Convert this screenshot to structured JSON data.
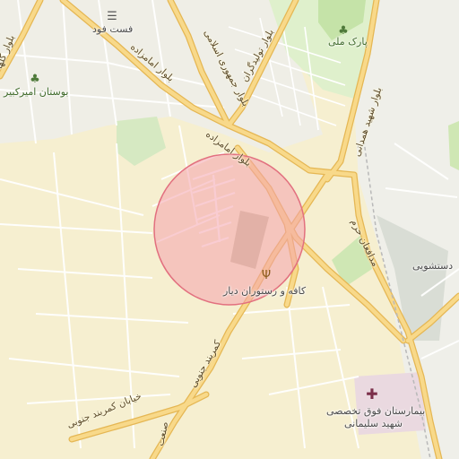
{
  "colors": {
    "land": "#f6efd0",
    "urban": "#efefe9",
    "park": "#cfe7b4",
    "water_grey": "#d7dcd6",
    "major_road": "#f6d27a",
    "major_road_edge": "#e5b754",
    "minor_road": "#ffffff",
    "circle_fill": "#f4a3ad",
    "circle_stroke": "#e2707f",
    "hospital": "#e7b7c4"
  },
  "pois": {
    "fast_food": "فست فود",
    "park_mellat": "پارک ملی",
    "amir_kabir_garden": "بوستان امیرکبیر",
    "cafe_dayar": "کافه و رستوران دیار",
    "dastshooyi": "دستشویی",
    "hospital_line1": "بیمارستان فوق تخصصی",
    "hospital_line2": "شهید سلیمانی"
  },
  "roads": {
    "golha": "بلوار گلها",
    "imamzadeh_top": "بلوار امامزاده",
    "jomhouri": "بلوار جمهوری اسلامی",
    "tolidgaran": "بلوار تولیدگران",
    "imamzadeh_mid": "بلوار امامزاده",
    "shahid_hamedani": "بلوار شهید همدانی",
    "modafean_haram": "مدافعان حرم",
    "kamarband_jonubi": "کمربند جنوبی",
    "khiaban_kamarband": "خیابان کمربند جنوبی",
    "sanat": "صنعت"
  },
  "icons": {
    "fast_food": "burger-icon",
    "park": "tree-icon",
    "garden": "tree-icon",
    "cafe": "restaurant-icon",
    "hospital": "cross-icon"
  }
}
